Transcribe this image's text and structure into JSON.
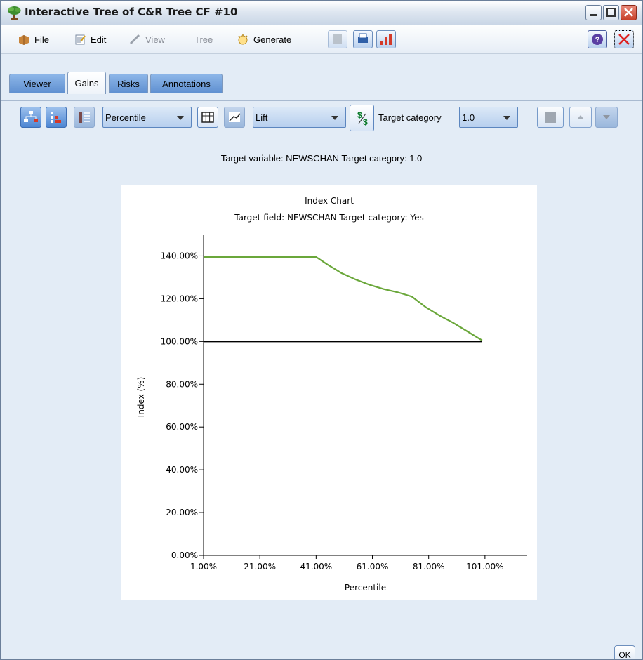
{
  "window": {
    "title": "Interactive Tree of C&R Tree CF #10",
    "icon": "tree-icon"
  },
  "menu": {
    "file": "File",
    "edit": "Edit",
    "view": "View",
    "tree": "Tree",
    "generate": "Generate"
  },
  "tabs": [
    {
      "label": "Viewer",
      "active": false
    },
    {
      "label": "Gains",
      "active": true
    },
    {
      "label": "Risks",
      "active": false
    },
    {
      "label": "Annotations",
      "active": false
    }
  ],
  "toolbar": {
    "percentile_select": "Percentile",
    "measure_select": "Lift",
    "target_category_label": "Target category",
    "target_category_value": "1.0"
  },
  "content": {
    "target_info": "Target variable: NEWSCHAN   Target category: 1.0"
  },
  "ok_label": "OK",
  "colors": {
    "accent": "#4d86d3",
    "series_line": "#6aa73a",
    "baseline": "#000000"
  },
  "chart_data": {
    "type": "line",
    "title": "Index Chart",
    "subtitle": "Target field: NEWSCHAN  Target category: Yes",
    "xlabel": "Percentile",
    "ylabel": "Index (%)",
    "x_ticks": [
      "1.00%",
      "21.00%",
      "41.00%",
      "61.00%",
      "81.00%",
      "101.00%"
    ],
    "y_ticks": [
      "0.00%",
      "20.00%",
      "40.00%",
      "60.00%",
      "80.00%",
      "100.00%",
      "120.00%",
      "140.00%"
    ],
    "xlim": [
      1,
      116
    ],
    "ylim": [
      0,
      150
    ],
    "grid": false,
    "series": [
      {
        "x": [
          1,
          10,
          20,
          30,
          41,
          45,
          50,
          55,
          60,
          65,
          70,
          75,
          80,
          85,
          90,
          95,
          100
        ],
        "values": [
          139.5,
          139.5,
          139.5,
          139.5,
          139.5,
          136,
          132,
          129,
          126.5,
          124.5,
          123,
          121,
          116,
          112,
          108.5,
          104.5,
          100.5
        ]
      },
      {
        "x": [
          1,
          100
        ],
        "values": [
          100,
          100
        ]
      }
    ]
  }
}
